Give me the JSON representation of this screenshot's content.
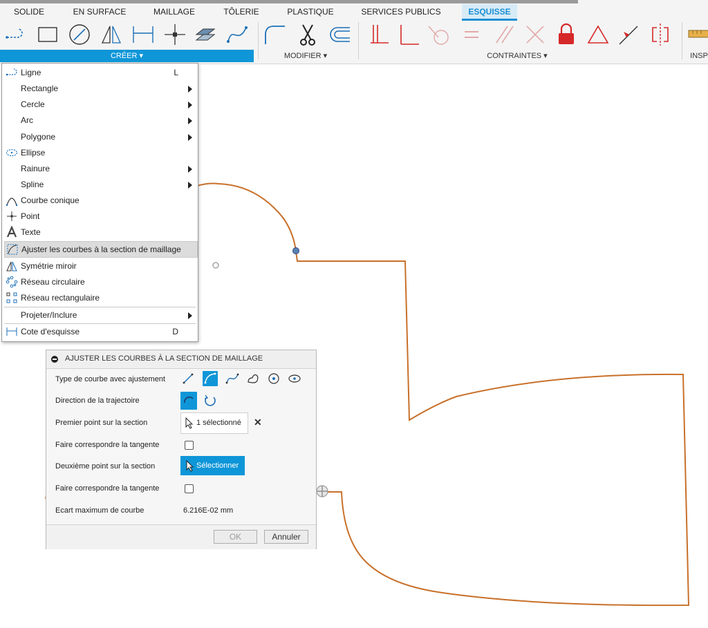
{
  "tabs": [
    "SOLIDE",
    "EN SURFACE",
    "MAILLAGE",
    "TÔLERIE",
    "PLASTIQUE",
    "SERVICES PUBLICS",
    "ESQUISSE"
  ],
  "active_tab": "ESQUISSE",
  "groups": {
    "create": "CRÉER ▾",
    "modify": "MODIFIER ▾",
    "constraints": "CONTRAINTES ▾",
    "inspect": "INSP"
  },
  "menu": {
    "items": [
      {
        "label": "Ligne",
        "shortcut": "L",
        "icon": "line-icon"
      },
      {
        "label": "Rectangle",
        "submenu": true
      },
      {
        "label": "Cercle",
        "submenu": true
      },
      {
        "label": "Arc",
        "submenu": true
      },
      {
        "label": "Polygone",
        "submenu": true
      },
      {
        "label": "Ellipse",
        "icon": "ellipse-icon"
      },
      {
        "label": "Rainure",
        "submenu": true
      },
      {
        "label": "Spline",
        "submenu": true
      },
      {
        "label": "Courbe conique",
        "icon": "conic-curve-icon"
      },
      {
        "label": "Point",
        "icon": "point-icon"
      },
      {
        "label": "Texte",
        "icon": "text-icon"
      },
      {
        "label": "Ajuster les courbes à la section de maillage",
        "icon": "fit-curves-icon",
        "highlighted": true
      },
      {
        "label": "Symétrie miroir",
        "icon": "mirror-icon"
      },
      {
        "label": "Réseau circulaire",
        "icon": "circular-pattern-icon"
      },
      {
        "label": "Réseau rectangulaire",
        "icon": "rectangular-pattern-icon"
      },
      {
        "label": "Projeter/Inclure",
        "submenu": true
      },
      {
        "label": "Cote d'esquisse",
        "shortcut": "D",
        "icon": "sketch-dimension-icon"
      }
    ]
  },
  "dialog": {
    "title": "AJUSTER LES COURBES À LA SECTION DE MAILLAGE",
    "rows": {
      "curve_type": "Type de courbe avec ajustement",
      "path_direction": "Direction de la trajectoire",
      "first_point": "Premier point sur la section",
      "match_tangent_1": "Faire correspondre la tangente",
      "second_point": "Deuxième point sur la section",
      "match_tangent_2": "Faire correspondre la tangente",
      "max_deviation": "Ecart maximum de courbe"
    },
    "first_point_value": "1 sélectionné",
    "second_point_button": "Sélectionner",
    "max_deviation_value": "6.216E-02 mm",
    "ok": "OK",
    "cancel": "Annuler"
  },
  "colors": {
    "accent": "#0f96d8",
    "sketch_curve": "#c8702a",
    "constraint_red": "#d62828"
  }
}
